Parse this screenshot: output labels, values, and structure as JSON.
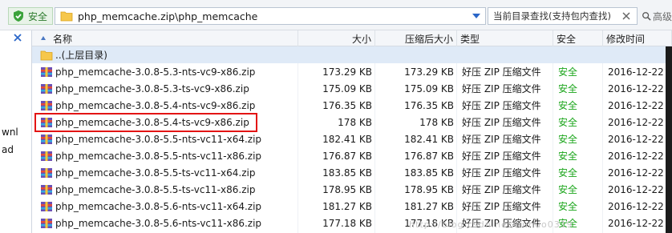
{
  "address_bar": {
    "secure_label": "安全",
    "path": "php_memcache.zip\\php_memcache",
    "search_placeholder": "当前目录查找(支持包内查找)",
    "advanced_label": "高级"
  },
  "left_fragments": [
    "wnl",
    "ad"
  ],
  "columns": {
    "name": "名称",
    "size": "大小",
    "packed": "压缩后大小",
    "type": "类型",
    "security": "安全",
    "modified": "修改时间"
  },
  "parent_row": {
    "name": "..(上层目录)"
  },
  "files": [
    {
      "name": "php_memcache-3.0.8-5.3-nts-vc9-x86.zip",
      "size": "173.29 KB",
      "packed": "173.29 KB",
      "type": "好压 ZIP 压缩文件",
      "security": "安全",
      "modified": "2016-12-22 ("
    },
    {
      "name": "php_memcache-3.0.8-5.3-ts-vc9-x86.zip",
      "size": "175.09 KB",
      "packed": "175.09 KB",
      "type": "好压 ZIP 压缩文件",
      "security": "安全",
      "modified": "2016-12-22 ("
    },
    {
      "name": "php_memcache-3.0.8-5.4-nts-vc9-x86.zip",
      "size": "176.35 KB",
      "packed": "176.35 KB",
      "type": "好压 ZIP 压缩文件",
      "security": "安全",
      "modified": "2016-12-22 ("
    },
    {
      "name": "php_memcache-3.0.8-5.4-ts-vc9-x86.zip",
      "size": "178 KB",
      "packed": "178 KB",
      "type": "好压 ZIP 压缩文件",
      "security": "安全",
      "modified": "2016-12-22 ("
    },
    {
      "name": "php_memcache-3.0.8-5.5-nts-vc11-x64.zip",
      "size": "182.41 KB",
      "packed": "182.41 KB",
      "type": "好压 ZIP 压缩文件",
      "security": "安全",
      "modified": "2016-12-22 ("
    },
    {
      "name": "php_memcache-3.0.8-5.5-nts-vc11-x86.zip",
      "size": "176.87 KB",
      "packed": "176.87 KB",
      "type": "好压 ZIP 压缩文件",
      "security": "安全",
      "modified": "2016-12-22 ("
    },
    {
      "name": "php_memcache-3.0.8-5.5-ts-vc11-x64.zip",
      "size": "183.85 KB",
      "packed": "183.85 KB",
      "type": "好压 ZIP 压缩文件",
      "security": "安全",
      "modified": "2016-12-22 ("
    },
    {
      "name": "php_memcache-3.0.8-5.5-ts-vc11-x86.zip",
      "size": "178.95 KB",
      "packed": "178.95 KB",
      "type": "好压 ZIP 压缩文件",
      "security": "安全",
      "modified": "2016-12-22 ("
    },
    {
      "name": "php_memcache-3.0.8-5.6-nts-vc11-x64.zip",
      "size": "181.27 KB",
      "packed": "181.27 KB",
      "type": "好压 ZIP 压缩文件",
      "security": "安全",
      "modified": "2016-12-22 ("
    },
    {
      "name": "php_memcache-3.0.8-5.6-nts-vc11-x86.zip",
      "size": "177.18 KB",
      "packed": "177.18 KB",
      "type": "好压 ZIP 压缩文件",
      "security": "安全",
      "modified": "2016-12-22 ("
    }
  ],
  "watermark": "http://blog.csdn.net/liuhuo0319",
  "colors": {
    "safe_green": "#1aa51a",
    "highlight_red": "#e31414",
    "parent_row_bg": "#dfeaf7"
  }
}
